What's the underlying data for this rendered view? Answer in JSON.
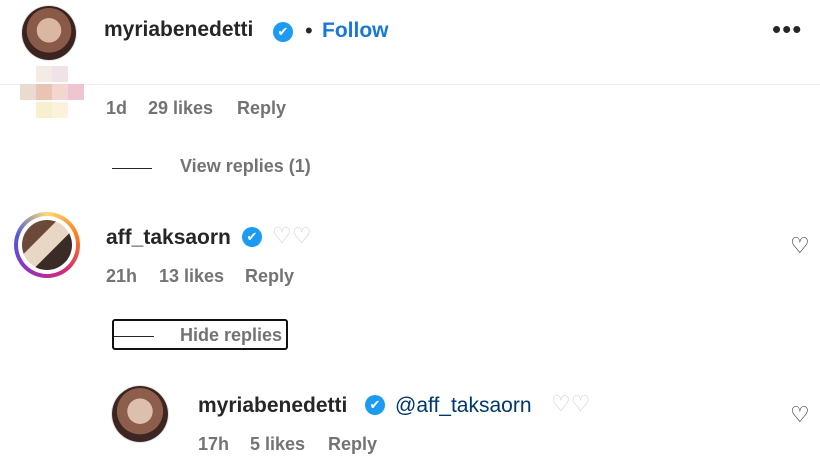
{
  "header": {
    "username": "myriabenedetti",
    "separator": "•",
    "follow_label": "Follow",
    "more_label": "•••"
  },
  "comment1": {
    "time": "1d",
    "likes": "29 likes",
    "reply_label": "Reply",
    "view_replies_label": "View replies (1)"
  },
  "comment2": {
    "username": "aff_taksaorn",
    "text": "♡♡",
    "time": "21h",
    "likes": "13 likes",
    "reply_label": "Reply",
    "hide_replies_label": "Hide replies"
  },
  "reply": {
    "username": "myriabenedetti",
    "mention": "@aff_taksaorn",
    "text": "♡♡",
    "time": "17h",
    "likes": "5 likes",
    "reply_label": "Reply"
  },
  "icons": {
    "verified": "✔",
    "like": "♡"
  },
  "colors": {
    "follow": "#1877d8",
    "verified": "#1d9bf0",
    "mention": "#00376b",
    "meta": "#737373"
  }
}
